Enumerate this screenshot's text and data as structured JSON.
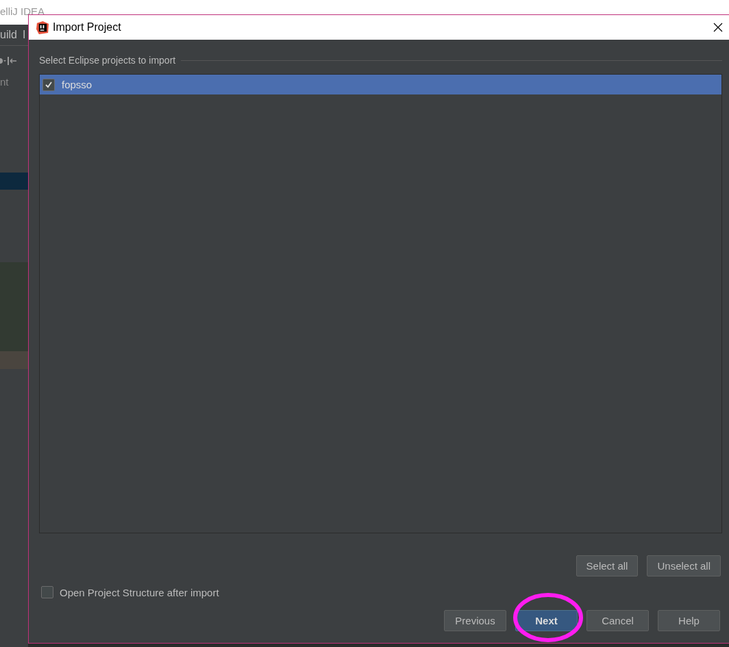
{
  "background_window": {
    "title": "elliJ IDEA",
    "menu_items": [
      "uild",
      "I"
    ],
    "side_text": "nt"
  },
  "dialog": {
    "title": "Import Project"
  },
  "projects_group": {
    "label": "Select Eclipse projects to import"
  },
  "projects": [
    {
      "name": "fopsso",
      "checked": true,
      "selected": true
    }
  ],
  "list_buttons": [
    "Select all",
    "Unselect all"
  ],
  "open_structure": {
    "label": "Open Project Structure after import",
    "checked": false
  },
  "buttons": [
    {
      "label": "Previous",
      "default": false
    },
    {
      "label": "Next",
      "default": true
    },
    {
      "label": "Cancel",
      "default": false
    },
    {
      "label": "Help",
      "default": false
    }
  ]
}
